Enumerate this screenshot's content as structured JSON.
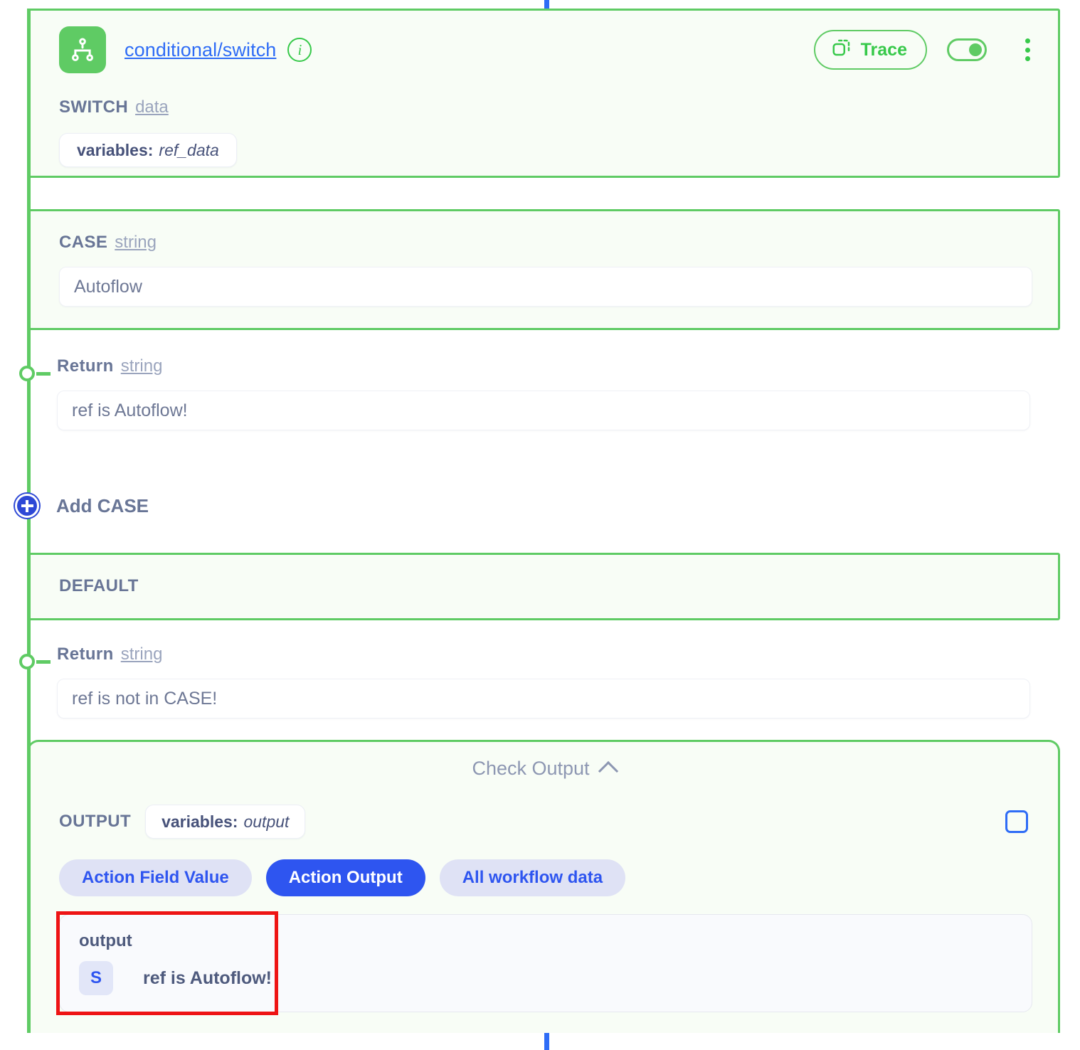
{
  "node": {
    "icon_name": "switch-node-icon",
    "title": "conditional/switch",
    "info_icon": "info-icon",
    "trace_label": "Trace",
    "trace_icon": "duplicate-icon",
    "toggle_state": "on",
    "kebab_icon": "more-vertical-icon"
  },
  "switch_section": {
    "label": "SWITCH",
    "type": "data",
    "variable_prefix": "variables:",
    "variable_name": "ref_data"
  },
  "case_section": {
    "label": "CASE",
    "type": "string",
    "value": "Autoflow"
  },
  "case_return": {
    "label": "Return",
    "type": "string",
    "value": "ref is Autoflow!"
  },
  "add_case": {
    "label": "Add CASE",
    "icon": "plus-circle-icon"
  },
  "default_section": {
    "label": "DEFAULT"
  },
  "default_return": {
    "label": "Return",
    "type": "string",
    "value": "ref is not in CASE!"
  },
  "check_output": {
    "title": "Check Output",
    "collapse_icon": "chevron-up-icon",
    "output_label": "OUTPUT",
    "variable_prefix": "variables:",
    "variable_name": "output",
    "checkbox_state": "unchecked",
    "tabs": [
      {
        "label": "Action Field Value",
        "active": false
      },
      {
        "label": "Action Output",
        "active": true
      },
      {
        "label": "All workflow data",
        "active": false
      }
    ],
    "result": {
      "key": "output",
      "type_badge": "S",
      "value": "ref is Autoflow!"
    }
  },
  "colors": {
    "accent_green": "#5fcb64",
    "accent_blue": "#2e55f0",
    "link_blue": "#2e6cf6",
    "highlight_red": "#ee1414",
    "panel_bg": "#f8fdf6",
    "label_gray": "#687596"
  }
}
